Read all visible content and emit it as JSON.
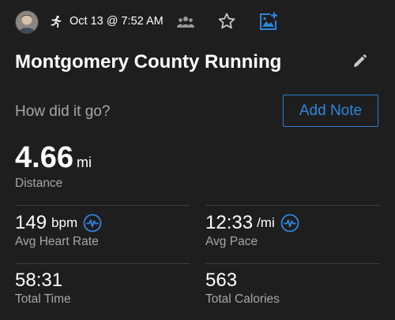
{
  "header": {
    "datetime": "Oct 13 @ 7:52 AM"
  },
  "activity": {
    "title": "Montgomery County Running"
  },
  "note": {
    "prompt": "How did it go?",
    "button_label": "Add Note"
  },
  "stats": {
    "distance": {
      "value": "4.66",
      "unit": "mi",
      "label": "Distance"
    },
    "avg_heart_rate": {
      "value": "149",
      "unit": "bpm",
      "label": "Avg Heart Rate"
    },
    "avg_pace": {
      "value": "12:33",
      "unit": "/mi",
      "label": "Avg Pace"
    },
    "total_time": {
      "value": "58:31",
      "label": "Total Time"
    },
    "total_calories": {
      "value": "563",
      "label": "Total Calories"
    }
  },
  "colors": {
    "background": "#1e1e1e",
    "accent_blue": "#2f86de",
    "secondary_text": "#a7a7a7",
    "divider": "#3c3c3c"
  },
  "icons": {
    "activity_type": "running-person-icon",
    "group": "group-icon",
    "favorite": "star-outline-icon",
    "add_photo": "add-photo-icon",
    "edit": "pencil-icon",
    "heart_rate_chart": "heart-rate-wave-icon",
    "pace_chart": "heart-rate-wave-icon"
  }
}
